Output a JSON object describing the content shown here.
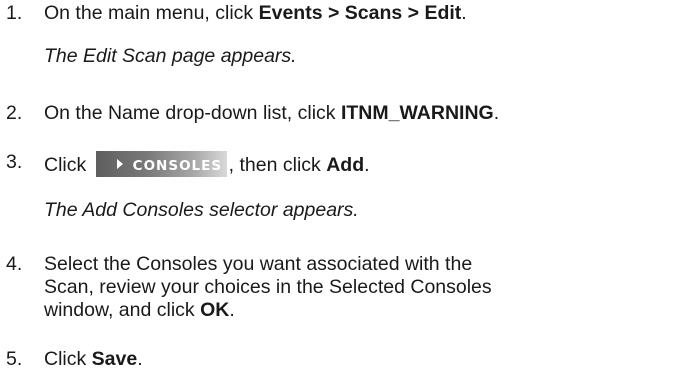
{
  "steps": [
    {
      "number": "1.",
      "text_a": "On the main menu, click ",
      "bold_a": "Events > Scans > Edit",
      "text_b": ".",
      "result": "The Edit Scan page appears."
    },
    {
      "number": "2.",
      "text_a": "On the Name drop-down list, click ",
      "bold_a": "ITNM_WARNING",
      "text_b": "."
    },
    {
      "number": "3.",
      "text_a": "Click ",
      "button_label": "CONSOLES",
      "text_b": ", then click ",
      "bold_a": "Add",
      "text_c": ".",
      "result": "The Add Consoles selector appears."
    },
    {
      "number": "4.",
      "line1": "Select the Consoles you want associated with the",
      "line2": "Scan, review your choices in the Selected Consoles",
      "line3_a": "window, and click ",
      "bold_a": "OK",
      "line3_b": "."
    },
    {
      "number": "5.",
      "text_a": "Click ",
      "bold_a": "Save",
      "text_b": "."
    }
  ]
}
